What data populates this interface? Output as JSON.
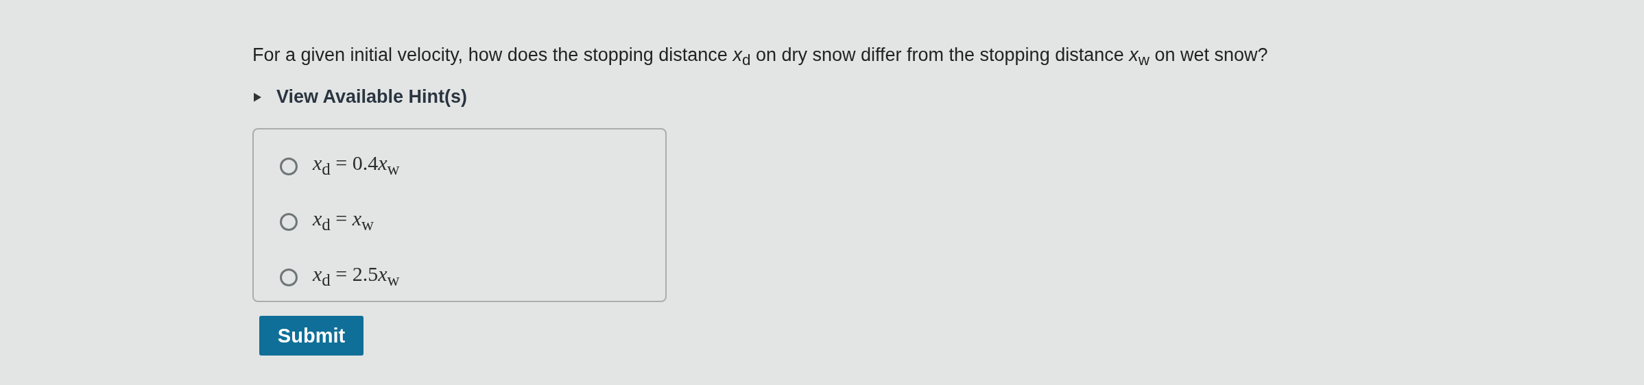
{
  "question": "For a given initial velocity, how does the stopping distance *x*$_{d}$ on dry snow differ from the stopping distance *x*$_{w}$ on wet snow?",
  "hints": {
    "label": "View Available Hint(s)",
    "expanded": false
  },
  "options": [
    {
      "lhs": "*x*$_{d}$",
      "relation": "=",
      "coefficient": "0.4",
      "rhs": "*x*$_{w}$",
      "selected": false
    },
    {
      "lhs": "*x*$_{d}$",
      "relation": "=",
      "rhs": "*x*$_{w}$",
      "selected": false
    },
    {
      "lhs": "*x*$_{d}$",
      "relation": "=",
      "coefficient": "2.5",
      "rhs": "*x*$_{w}$",
      "selected": false
    }
  ],
  "submit": "Submit"
}
